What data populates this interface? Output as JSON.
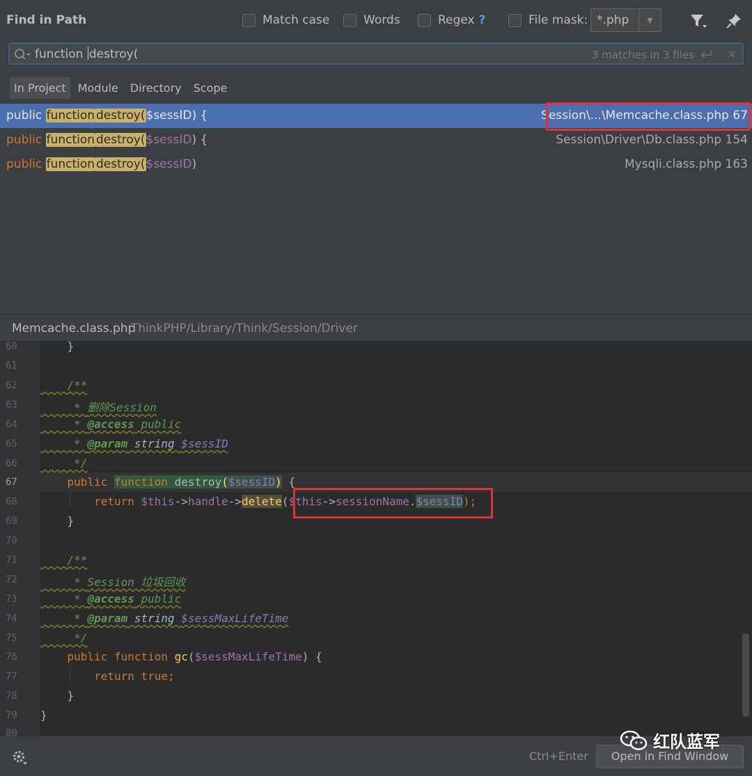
{
  "header": {
    "title": "Find in Path",
    "options": [
      {
        "label": "Match case"
      },
      {
        "label": "Words"
      },
      {
        "label": "Regex"
      },
      {
        "label": "File mask:"
      }
    ],
    "regex_help": "?",
    "file_mask_value": "*.php"
  },
  "search": {
    "query_before_caret": "function ",
    "query_after_caret": "destroy(",
    "match_count": "3 matches in 3 files"
  },
  "scopes": [
    {
      "label": "In Project",
      "active": true
    },
    {
      "label": "Module",
      "active": false
    },
    {
      "label": "Directory",
      "active": false
    },
    {
      "label": "Scope",
      "active": false
    }
  ],
  "results": [
    {
      "prefix": "public ",
      "m1": "function",
      "m2": "destroy(",
      "var": "$sessID",
      "suffix": ") {",
      "path": "Session\\...\\Memcache.class.php 67",
      "selected": true
    },
    {
      "prefix": "public ",
      "m1": "function",
      "m2": "destroy(",
      "var": "$sessID",
      "suffix": ") {",
      "path": "Session\\Driver\\Db.class.php 154",
      "selected": false
    },
    {
      "prefix": "public ",
      "m1": "function",
      "m2": "destroy(",
      "var": "$sessID",
      "suffix": ")",
      "path": "Mysqli.class.php 163",
      "selected": false
    }
  ],
  "file": {
    "name": "Memcache.class.php",
    "path": "ThinkPHP/Library/Think/Session/Driver"
  },
  "editor": {
    "line_numbers": [
      "60",
      "61",
      "62",
      "63",
      "64",
      "65",
      "66",
      "67",
      "68",
      "69",
      "70",
      "71",
      "72",
      "73",
      "74",
      "75",
      "76",
      "77",
      "78",
      "79",
      "80"
    ],
    "current_line": "67",
    "code": {
      "l60": "    }",
      "l62": "    /**",
      "l63a": "     * ",
      "l63b": "删除Session",
      "l64a": "     * ",
      "l64b": "@access",
      "l64c": " public",
      "l65a": "     * ",
      "l65b": "@param",
      "l65c": " string ",
      "l65d": "$sessID",
      "l66": "     */",
      "l67a": "    public ",
      "l67b": "function",
      "l67c": " destroy",
      "l67d": "(",
      "l67e": "$sessID",
      "l67f": ")",
      "l67g": " {",
      "l68a": "        return ",
      "l68b": "$this",
      "l68c": "->",
      "l68d": "handle",
      "l68e": "->",
      "l68f": "delete",
      "l68g": "(",
      "l68h": "$this",
      "l68i": "->",
      "l68j": "sessionName",
      "l68k": ".",
      "l68l": "$sessID",
      "l68m": ");",
      "l69": "    }",
      "l71": "    /**",
      "l72a": "     * ",
      "l72b": "Session 垃圾回收",
      "l73a": "     * ",
      "l73b": "@access",
      "l73c": " public",
      "l74a": "     * ",
      "l74b": "@param",
      "l74c": " string ",
      "l74d": "$sessMaxLifeTime",
      "l75": "     */",
      "l76a": "    public ",
      "l76b": "function ",
      "l76c": "gc",
      "l76d": "(",
      "l76e": "$sessMaxLifeTime",
      "l76f": ") {",
      "l77a": "        return ",
      "l77b": "true;",
      "l78": "    }",
      "l79": "}"
    }
  },
  "bottom": {
    "shortcut": "Ctrl+Enter",
    "open_button": "Open in Find Window"
  },
  "watermark": {
    "text": "红队蓝军"
  },
  "colors": {
    "accent": "#4b6eaf",
    "match_highlight": "#c9b168",
    "annotation_box": "#e0313b"
  }
}
